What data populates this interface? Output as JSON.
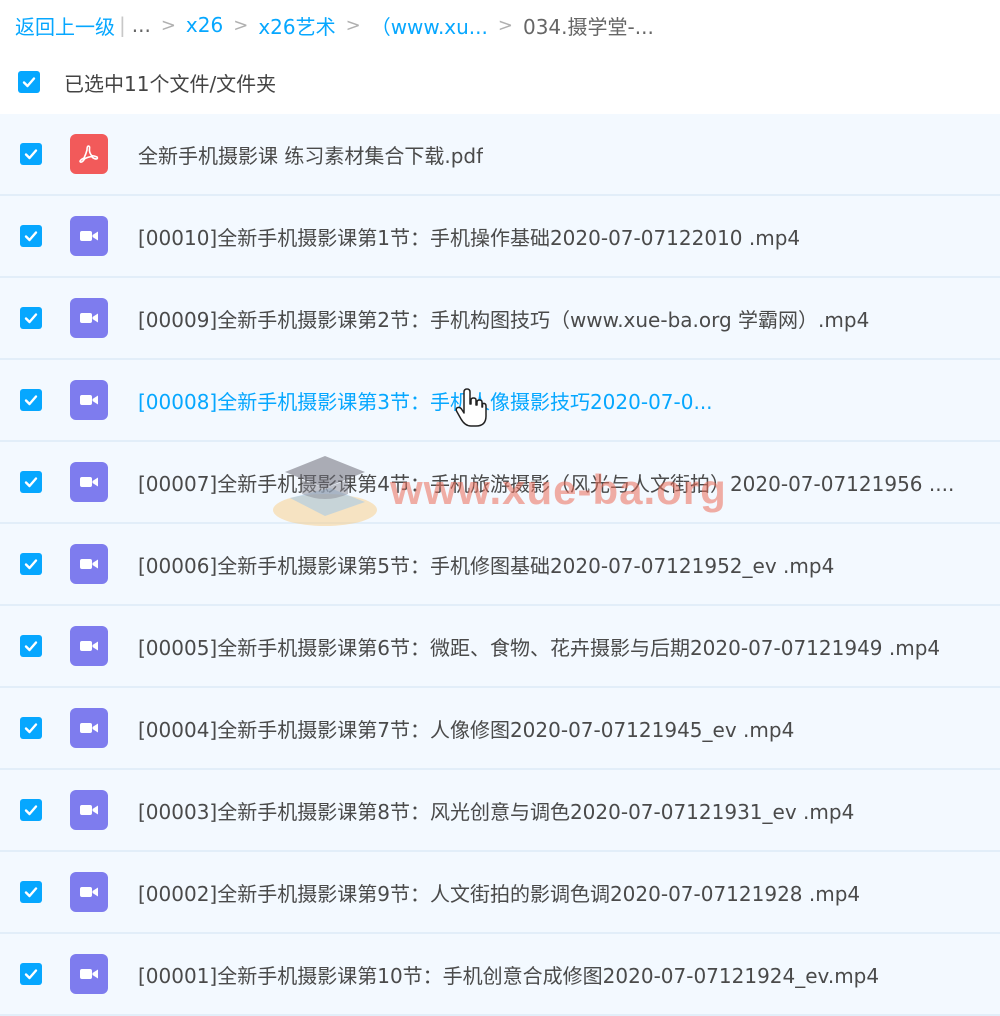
{
  "breadcrumb": {
    "back": "返回上一级",
    "separator_bar": "|",
    "ellipsis": "...",
    "crumbs": [
      "x26",
      "x26艺术",
      "（www.xu...",
      "034.摄学堂-..."
    ],
    "sep": ">"
  },
  "selection": {
    "label": "已选中11个文件/文件夹",
    "checked": true
  },
  "files": [
    {
      "name": "全新手机摄影课 练习素材集合下载.pdf",
      "type": "pdf",
      "icon": "pdf-file-icon",
      "checked": true
    },
    {
      "name": "[00010]全新手机摄影课第1节：手机操作基础2020-07-07122010 .mp4",
      "type": "video",
      "icon": "video-file-icon",
      "checked": true
    },
    {
      "name": "[00009]全新手机摄影课第2节：手机构图技巧（www.xue-ba.org 学霸网）.mp4",
      "type": "video",
      "icon": "video-file-icon",
      "checked": true
    },
    {
      "name": "[00008]全新手机摄影课第3节：手机人像摄影技巧2020-07-0...",
      "type": "video",
      "icon": "video-file-icon",
      "checked": true,
      "hover": true
    },
    {
      "name": "[00007]全新手机摄影课第4节：手机旅游摄影（风光与人文街拍）2020-07-07121956 ....",
      "type": "video",
      "icon": "video-file-icon",
      "checked": true
    },
    {
      "name": "[00006]全新手机摄影课第5节：手机修图基础2020-07-07121952_ev .mp4",
      "type": "video",
      "icon": "video-file-icon",
      "checked": true
    },
    {
      "name": "[00005]全新手机摄影课第6节：微距、食物、花卉摄影与后期2020-07-07121949 .mp4",
      "type": "video",
      "icon": "video-file-icon",
      "checked": true
    },
    {
      "name": "[00004]全新手机摄影课第7节：人像修图2020-07-07121945_ev .mp4",
      "type": "video",
      "icon": "video-file-icon",
      "checked": true
    },
    {
      "name": "[00003]全新手机摄影课第8节：风光创意与调色2020-07-07121931_ev .mp4",
      "type": "video",
      "icon": "video-file-icon",
      "checked": true
    },
    {
      "name": "[00002]全新手机摄影课第9节：人文街拍的影调色调2020-07-07121928 .mp4",
      "type": "video",
      "icon": "video-file-icon",
      "checked": true
    },
    {
      "name": "[00001]全新手机摄影课第10节：手机创意合成修图2020-07-07121924_ev.mp4",
      "type": "video",
      "icon": "video-file-icon",
      "checked": true
    }
  ],
  "watermark": {
    "text": "www.xue-ba.org"
  },
  "colors": {
    "accent": "#06a7ff",
    "row_bg": "#f3f9ff",
    "pdf_icon": "#f25a5a",
    "video_icon": "#7e7cee"
  }
}
